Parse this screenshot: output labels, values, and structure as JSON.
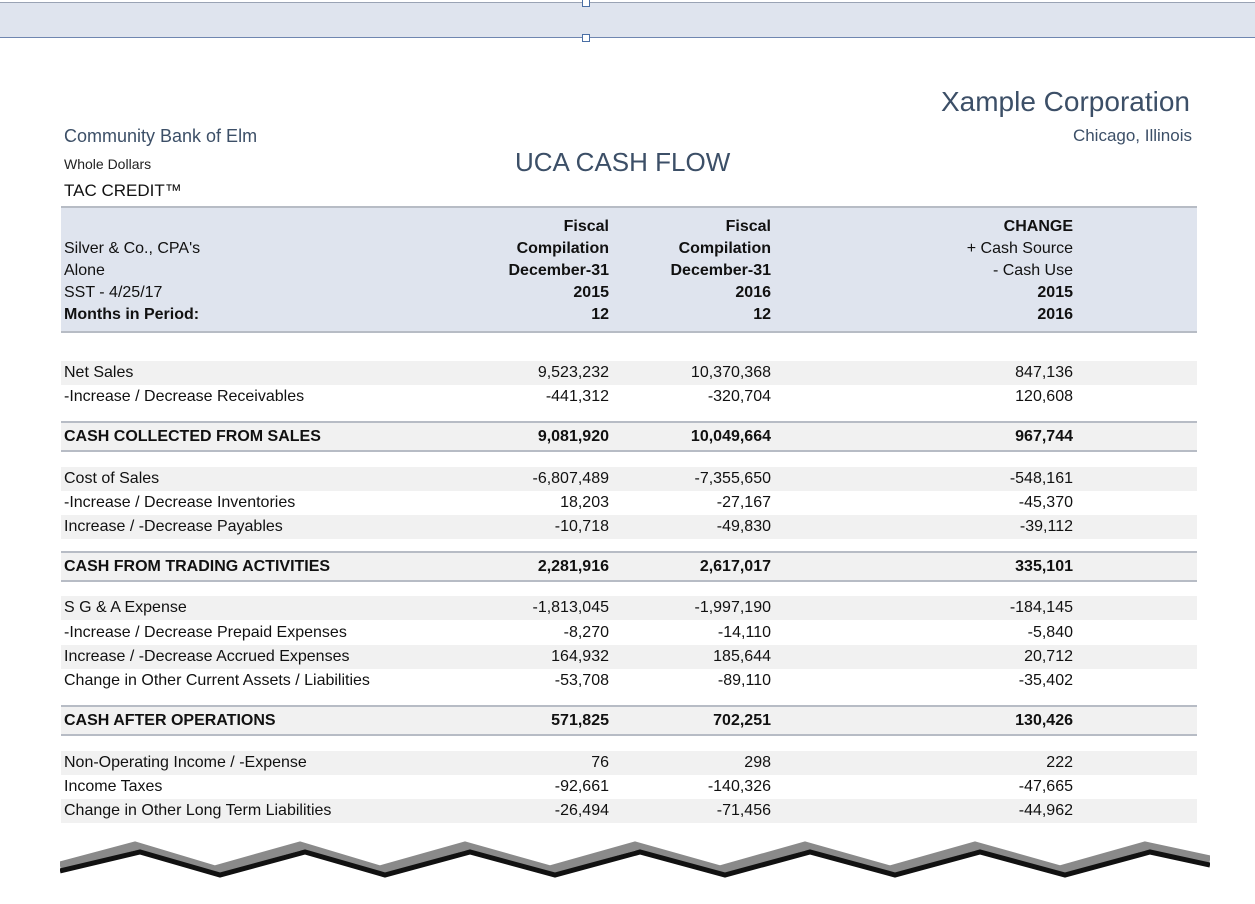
{
  "header": {
    "company_name": "Xample Corporation",
    "company_location": "Chicago, Illinois",
    "bank_name": "Community Bank of Elm",
    "units": "Whole Dollars",
    "product": "TAC CREDIT™",
    "report_title": "UCA CASH FLOW"
  },
  "column_header": {
    "left": [
      "Silver & Co., CPA's",
      "Alone",
      "SST - 4/25/17",
      "Months in Period:"
    ],
    "col1": [
      "Fiscal",
      "Compilation",
      "December-31",
      "2015",
      "12"
    ],
    "col2": [
      "Fiscal",
      "Compilation",
      "December-31",
      "2016",
      "12"
    ],
    "col3": [
      "CHANGE",
      "+ Cash Source",
      "- Cash Use",
      "2015",
      "2016"
    ]
  },
  "rows": [
    {
      "label": "Net Sales",
      "v1": "9,523,232",
      "v2": "10,370,368",
      "v3": "847,136"
    },
    {
      "label": "-Increase / Decrease Receivables",
      "v1": "-441,312",
      "v2": "-320,704",
      "v3": "120,608"
    },
    {
      "label": "CASH COLLECTED FROM SALES",
      "v1": "9,081,920",
      "v2": "10,049,664",
      "v3": "967,744"
    },
    {
      "label": "Cost of Sales",
      "v1": "-6,807,489",
      "v2": "-7,355,650",
      "v3": "-548,161"
    },
    {
      "label": "-Increase / Decrease Inventories",
      "v1": "18,203",
      "v2": "-27,167",
      "v3": "-45,370"
    },
    {
      "label": "Increase / -Decrease Payables",
      "v1": "-10,718",
      "v2": "-49,830",
      "v3": "-39,112"
    },
    {
      "label": "CASH FROM TRADING ACTIVITIES",
      "v1": "2,281,916",
      "v2": "2,617,017",
      "v3": "335,101"
    },
    {
      "label": "S G & A Expense",
      "v1": "-1,813,045",
      "v2": "-1,997,190",
      "v3": "-184,145"
    },
    {
      "label": "-Increase / Decrease Prepaid Expenses",
      "v1": "-8,270",
      "v2": "-14,110",
      "v3": "-5,840"
    },
    {
      "label": "Increase / -Decrease Accrued Expenses",
      "v1": "164,932",
      "v2": "185,644",
      "v3": "20,712"
    },
    {
      "label": "Change in Other Current Assets / Liabilities",
      "v1": "-53,708",
      "v2": "-89,110",
      "v3": "-35,402"
    },
    {
      "label": "CASH AFTER OPERATIONS",
      "v1": "571,825",
      "v2": "702,251",
      "v3": "130,426"
    },
    {
      "label": "Non-Operating Income / -Expense",
      "v1": "76",
      "v2": "298",
      "v3": "222"
    },
    {
      "label": "Income Taxes",
      "v1": "-92,661",
      "v2": "-140,326",
      "v3": "-47,665"
    },
    {
      "label": "Change in Other Long Term Liabilities",
      "v1": "-26,494",
      "v2": "-71,456",
      "v3": "-44,962"
    }
  ]
}
